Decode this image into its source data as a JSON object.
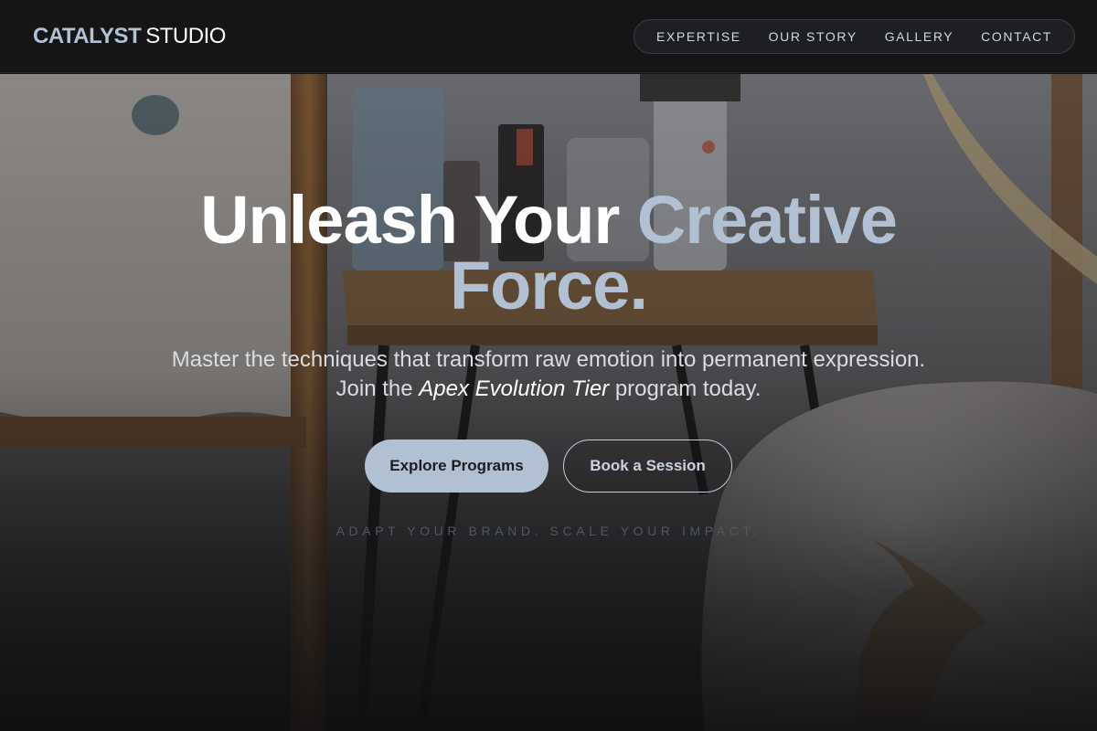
{
  "brand": {
    "name_strong": "CATALYST",
    "name_light": "STUDIO",
    "accent_color": "#b2c0d3"
  },
  "nav": {
    "items": [
      {
        "label": "EXPERTISE"
      },
      {
        "label": "OUR STORY"
      },
      {
        "label": "GALLERY"
      },
      {
        "label": "CONTACT"
      }
    ]
  },
  "hero": {
    "headline_white": "Unleash Your",
    "headline_accent_1": "Creative",
    "headline_accent_2": "Force.",
    "subtext_line1": "Master the techniques that transform raw emotion into permanent expression.",
    "subtext_join": "Join the",
    "subtext_highlight": "Apex Evolution Tier",
    "subtext_end": "program today.",
    "primary_button": "Explore Programs",
    "secondary_button": "Book a Session",
    "tagline": "ADAPT YOUR BRAND. SCALE YOUR IMPACT."
  }
}
